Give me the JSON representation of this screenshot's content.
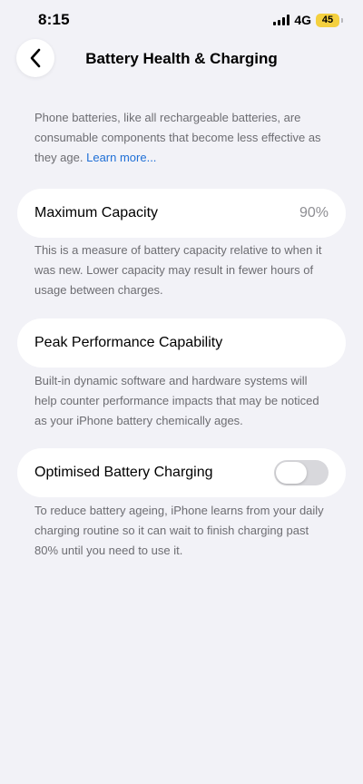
{
  "status_bar": {
    "time": "8:15",
    "network": "4G",
    "battery_level": "45",
    "battery_color": "#f4d03f"
  },
  "nav": {
    "title": "Battery Health & Charging",
    "back_icon": "chevron-left-icon"
  },
  "intro": {
    "text": "Phone batteries, like all rechargeable batteries, are consumable components that become less effective as they age. ",
    "link_label": "Learn more..."
  },
  "maximum_capacity": {
    "label": "Maximum Capacity",
    "value": "90%",
    "footer": "This is a measure of battery capacity relative to when it was new. Lower capacity may result in fewer hours of usage between charges."
  },
  "peak_performance": {
    "label": "Peak Performance Capability",
    "footer": "Built-in dynamic software and hardware systems will help counter performance impacts that may be noticed as your iPhone battery chemically ages."
  },
  "optimised_charging": {
    "label": "Optimised Battery Charging",
    "enabled": false,
    "footer": "To reduce battery ageing, iPhone learns from your daily charging routine so it can wait to finish charging past 80% until you need to use it."
  },
  "colors": {
    "background": "#f2f2f7",
    "link": "#1f6fd6",
    "secondary_text": "#6d6d72"
  }
}
